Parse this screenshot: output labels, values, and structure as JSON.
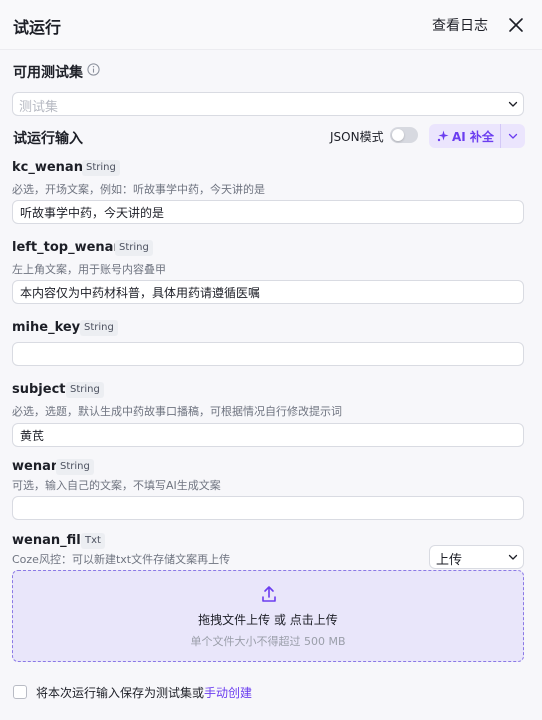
{
  "header": {
    "title": "试运行",
    "view_logs": "查看日志"
  },
  "test_set": {
    "title": "可用测试集",
    "placeholder": "测试集"
  },
  "run_input": {
    "title": "试运行输入",
    "json_mode_label": "JSON模式",
    "json_mode_on": false,
    "ai_fill_label": "AI 补全"
  },
  "fields": [
    {
      "name": "kc_wenan",
      "required": true,
      "type": "String",
      "description": "必选，开场文案，例如：听故事学中药，今天讲的是",
      "value": "听故事学中药，今天讲的是"
    },
    {
      "name": "left_top_wenan",
      "required": true,
      "type": "String",
      "description": "左上角文案，用于账号内容叠甲",
      "value": "本内容仅为中药材科普，具体用药请遵循医嘱"
    },
    {
      "name": "mihe_key",
      "required": true,
      "type": "String",
      "description": "",
      "value": ""
    },
    {
      "name": "subject",
      "required": true,
      "type": "String",
      "description": "必选，选题，默认生成中药故事口播稿，可根据情况自行修改提示词",
      "value": "黄芪"
    },
    {
      "name": "wenan",
      "required": false,
      "type": "String",
      "description": "可选，输入自己的文案，不填写AI生成文案",
      "value": ""
    },
    {
      "name": "wenan_file",
      "required": false,
      "type": "Txt",
      "description": "Coze风控：可以新建txt文件存储文案再上传"
    }
  ],
  "upload": {
    "mode": "上传",
    "drop_main": "拖拽文件上传 或 点击上传",
    "drop_sub": "单个文件大小不得超过 500 MB"
  },
  "footer": {
    "save_text": "将本次运行输入保存为测试集或",
    "manual_create": "手动创建",
    "checked": false
  },
  "colors": {
    "accent": "#6b3df0",
    "required": "#e5484d",
    "dropzone_bg": "#e9e6fa"
  }
}
